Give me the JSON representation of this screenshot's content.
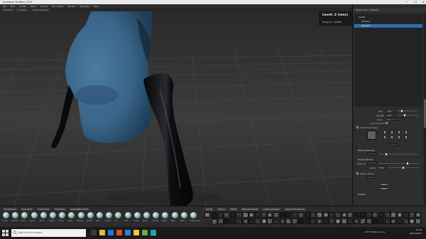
{
  "window": {
    "title": "Autodesk Mudbox 2019",
    "controls": [
      "—",
      "☐",
      "✕"
    ]
  },
  "menu": [
    "File",
    "Edit",
    "Create",
    "Mesh",
    "Curves",
    "UV & Maps",
    "Render",
    "Windows",
    "Help"
  ],
  "viewport_tabs": [
    "3D View",
    "UV View",
    "Image Browser"
  ],
  "hud": {
    "level": "Level: 2 (max)",
    "polygons": "Polygons: 113984"
  },
  "right_panel": {
    "tabs": [
      "Object List",
      "Viewport"
    ],
    "outliner_rows": [
      {
        "label": "sculpt",
        "selected": false
      },
      {
        "label": "Shaders",
        "selected": false
      },
      {
        "label": "pCube3",
        "selected": true
      }
    ],
    "properties": {
      "size_label": "Size",
      "size_value": "5.00",
      "strength_label": "Strength",
      "strength_value": "1.00",
      "mirror_label": "Mirror",
      "mirror_value": "off",
      "invert_label": "Invert Function",
      "use_stamp_label": "Use Stamp Image",
      "stamp_spacing_label": "Stamp Spacing",
      "steady_stroke_label": "Steady Stroke",
      "distance_label": "Distance",
      "falloff_label": "Falloff",
      "falloff_value": "35.00",
      "stabilize_label": "Steady Stroke",
      "presets_label": "Presets",
      "btn_save": "Save",
      "btn_reset": "Reset"
    }
  },
  "sculpt_tray": {
    "tabs": [
      "Sculpt Tools",
      "Paint Tools",
      "Curve Tools",
      "Pose Tools",
      "Select/Move Tools"
    ],
    "brushes": [
      "Sculpt",
      "Smooth",
      "Relax",
      "Grab",
      "Pinch",
      "Flatten",
      "Foamy",
      "Spray",
      "Repeat",
      "Imprint",
      "Wax",
      "Scrape",
      "Fill",
      "Knife",
      "Smear",
      "Bulge",
      "Amplify",
      "Freeze",
      "Mask",
      "Erase",
      "Sculpt Layer"
    ]
  },
  "stamp_tray": {
    "tabs": [
      "Stamp",
      "Stencil",
      "Falloff",
      "Material Presets",
      "Lighting Presets",
      "Camera Bookmarks"
    ],
    "off_label": "OFF"
  },
  "taskbar": {
    "search_placeholder": "Type here to search",
    "weather": "22°C  Mostly sunny",
    "time": "12:26",
    "date": "14/07/2022"
  },
  "colors": {
    "accent": "#2d6fb0",
    "shirt": "#3a6488",
    "glove": "#0b0b0d",
    "background": "#2b2b2b"
  }
}
